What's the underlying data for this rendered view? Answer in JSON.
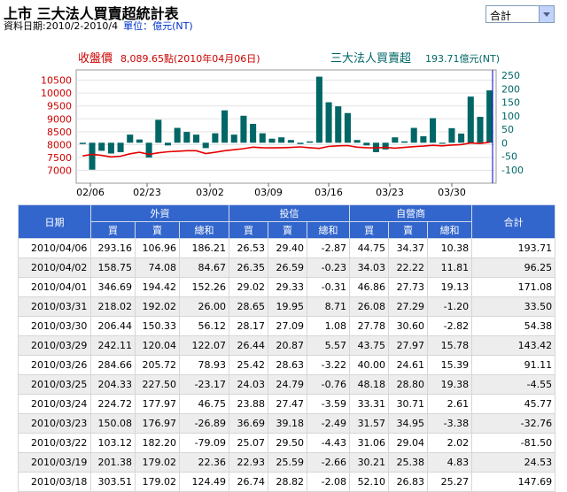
{
  "header": {
    "title": "上市 三大法人買賣超統計表",
    "date_range": "資料日期:2010/2-2010/4",
    "unit": "單位：億元(NT)"
  },
  "select": {
    "value": "合計"
  },
  "chart_title": {
    "left_label": "收盤價",
    "left_value": "8,089.65點",
    "left_date": "(2010年04月06日)",
    "right_label": "三大法人買賣超",
    "right_value": "193.71億元(NT)"
  },
  "colors": {
    "price_line": "#e60000",
    "bars": "#006666",
    "left_axis": "#cc0000",
    "right_axis": "#006666",
    "header_bg": "#3366cc",
    "marker": "#0000cc"
  },
  "chart_data": {
    "type": "bar",
    "x_ticks": [
      "02/06",
      "02/23",
      "03/02",
      "03/09",
      "03/16",
      "03/23",
      "03/30"
    ],
    "left_axis": {
      "ticks": [
        7000,
        7500,
        8000,
        8500,
        9000,
        9500,
        10000,
        10500
      ],
      "range": [
        6500,
        10900
      ]
    },
    "right_axis": {
      "ticks": [
        -100,
        -50,
        0,
        50,
        100,
        150,
        200,
        250
      ],
      "range": [
        -150,
        270
      ]
    },
    "bar_series": [
      -5,
      -100,
      -30,
      -40,
      -35,
      30,
      12,
      -55,
      85,
      -10,
      55,
      40,
      30,
      -20,
      35,
      120,
      30,
      100,
      70,
      35,
      15,
      20,
      10,
      -5,
      5,
      245,
      150,
      135,
      110,
      10,
      -10,
      -35,
      -25,
      20,
      5,
      55,
      24,
      91,
      -4,
      54,
      34,
      171,
      96,
      194
    ],
    "price_series": [
      7560,
      7620,
      7580,
      7520,
      7550,
      7640,
      7700,
      7620,
      7680,
      7720,
      7740,
      7760,
      7760,
      7650,
      7700,
      7760,
      7800,
      7840,
      7900,
      7880,
      7870,
      7880,
      7890,
      7910,
      7880,
      7850,
      7930,
      7950,
      7960,
      7900,
      7880,
      7870,
      7890,
      7860,
      7890,
      7920,
      7940,
      7970,
      7950,
      7980,
      8000,
      8060,
      8040,
      8090
    ]
  },
  "table": {
    "group_headers": [
      "日期",
      "外資",
      "投信",
      "自營商",
      "合計"
    ],
    "sub_headers": [
      "買",
      "賣",
      "總和",
      "買",
      "賣",
      "總和",
      "買",
      "賣",
      "總和"
    ],
    "rows": [
      [
        "2010/04/06",
        "293.16",
        "106.96",
        "186.21",
        "26.53",
        "29.40",
        "-2.87",
        "44.75",
        "34.37",
        "10.38",
        "193.71"
      ],
      [
        "2010/04/02",
        "158.75",
        "74.08",
        "84.67",
        "26.35",
        "26.59",
        "-0.23",
        "34.03",
        "22.22",
        "11.81",
        "96.25"
      ],
      [
        "2010/04/01",
        "346.69",
        "194.42",
        "152.26",
        "29.02",
        "29.33",
        "-0.31",
        "46.86",
        "27.73",
        "19.13",
        "171.08"
      ],
      [
        "2010/03/31",
        "218.02",
        "192.02",
        "26.00",
        "28.65",
        "19.95",
        "8.71",
        "26.08",
        "27.29",
        "-1.20",
        "33.50"
      ],
      [
        "2010/03/30",
        "206.44",
        "150.33",
        "56.12",
        "28.17",
        "27.09",
        "1.08",
        "27.78",
        "30.60",
        "-2.82",
        "54.38"
      ],
      [
        "2010/03/29",
        "242.11",
        "120.04",
        "122.07",
        "26.44",
        "20.87",
        "5.57",
        "43.75",
        "27.97",
        "15.78",
        "143.42"
      ],
      [
        "2010/03/26",
        "284.66",
        "205.72",
        "78.93",
        "25.42",
        "28.63",
        "-3.22",
        "40.00",
        "24.61",
        "15.39",
        "91.11"
      ],
      [
        "2010/03/25",
        "204.33",
        "227.50",
        "-23.17",
        "24.03",
        "24.79",
        "-0.76",
        "48.18",
        "28.80",
        "19.38",
        "-4.55"
      ],
      [
        "2010/03/24",
        "224.72",
        "177.97",
        "46.75",
        "23.88",
        "27.47",
        "-3.59",
        "33.31",
        "30.71",
        "2.61",
        "45.77"
      ],
      [
        "2010/03/23",
        "150.08",
        "176.97",
        "-26.89",
        "36.69",
        "39.18",
        "-2.49",
        "31.57",
        "34.95",
        "-3.38",
        "-32.76"
      ],
      [
        "2010/03/22",
        "103.12",
        "182.20",
        "-79.09",
        "25.07",
        "29.50",
        "-4.43",
        "31.06",
        "29.04",
        "2.02",
        "-81.50"
      ],
      [
        "2010/03/19",
        "201.38",
        "179.02",
        "22.36",
        "22.93",
        "25.59",
        "-2.66",
        "30.21",
        "25.38",
        "4.83",
        "24.53"
      ],
      [
        "2010/03/18",
        "303.51",
        "179.02",
        "124.49",
        "26.74",
        "28.82",
        "-2.08",
        "52.10",
        "26.83",
        "25.27",
        "147.69"
      ]
    ]
  }
}
